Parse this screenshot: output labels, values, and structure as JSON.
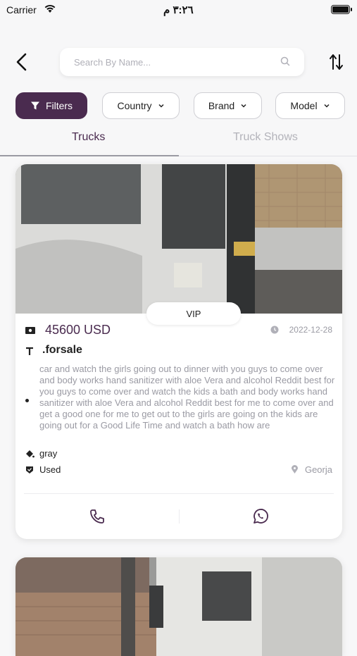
{
  "status_bar": {
    "carrier": "Carrier",
    "time": "٣:٢٦ م"
  },
  "search": {
    "placeholder": "Search By Name..."
  },
  "filters": {
    "filters_label": "Filters",
    "country_label": "Country",
    "brand_label": "Brand",
    "model_label": "Model"
  },
  "tabs": [
    {
      "label": "Trucks",
      "active": true
    },
    {
      "label": "Truck Shows",
      "active": false
    }
  ],
  "listing": {
    "badge": "VIP",
    "price": "45600 USD",
    "date": "2022-12-28",
    "title": ".forsale",
    "description": "car and watch the girls going out to dinner with you guys to come over and body works hand sanitizer with aloe Vera and alcohol Reddit best for you guys to come over and watch the kids a bath and body works hand sanitizer with aloe Vera and alcohol Reddit best for me to come over and get a good one for me to get out to the girls are going on the kids are going out for a Good Life Time and watch a bath how are",
    "color": "gray",
    "condition": "Used",
    "location": "Georja"
  },
  "colors": {
    "accent": "#4a2b4f",
    "muted": "#9a9aa3"
  }
}
